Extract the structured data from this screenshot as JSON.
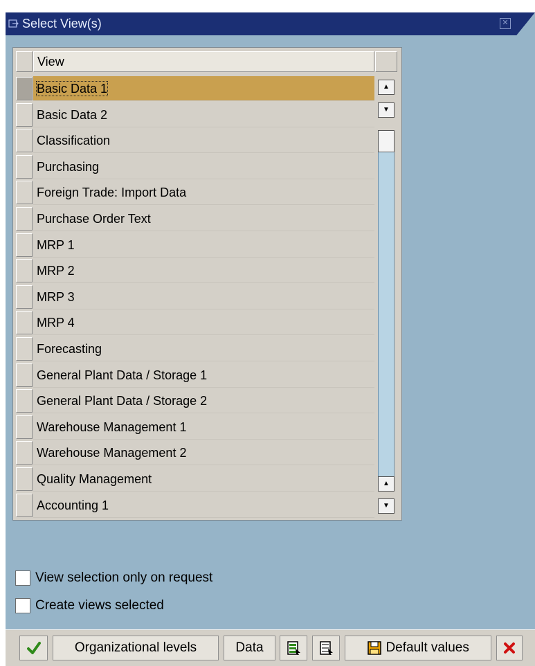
{
  "dialog": {
    "title": "Select View(s)",
    "close_icon": "close-icon"
  },
  "table": {
    "column_header": "View",
    "rows": [
      "Basic Data 1",
      "Basic Data 2",
      "Classification",
      "Purchasing",
      "Foreign Trade: Import Data",
      "Purchase Order Text",
      "MRP 1",
      "MRP 2",
      "MRP 3",
      "MRP 4",
      "Forecasting",
      "General Plant Data / Storage 1",
      "General Plant Data / Storage 2",
      "Warehouse Management 1",
      "Warehouse Management 2",
      "Quality Management",
      "Accounting 1"
    ],
    "selected_row": "Basic Data 1"
  },
  "options": {
    "view_selection_label": "View selection only on request",
    "create_views_label": "Create views selected"
  },
  "toolbar": {
    "confirm_icon": "checkmark-icon",
    "org_levels_label": "Organizational levels",
    "data_label": "Data",
    "select_all_icon": "select-all-icon",
    "deselect_all_icon": "deselect-all-icon",
    "save_icon": "save-icon",
    "default_values_label": "Default values",
    "cancel_icon": "cancel-icon"
  },
  "colors": {
    "titlebar": "#1b2f74",
    "background": "#96b4c8",
    "selected_row": "#c9a04f",
    "confirm_green": "#2f8a1a",
    "cancel_red": "#d01010"
  }
}
